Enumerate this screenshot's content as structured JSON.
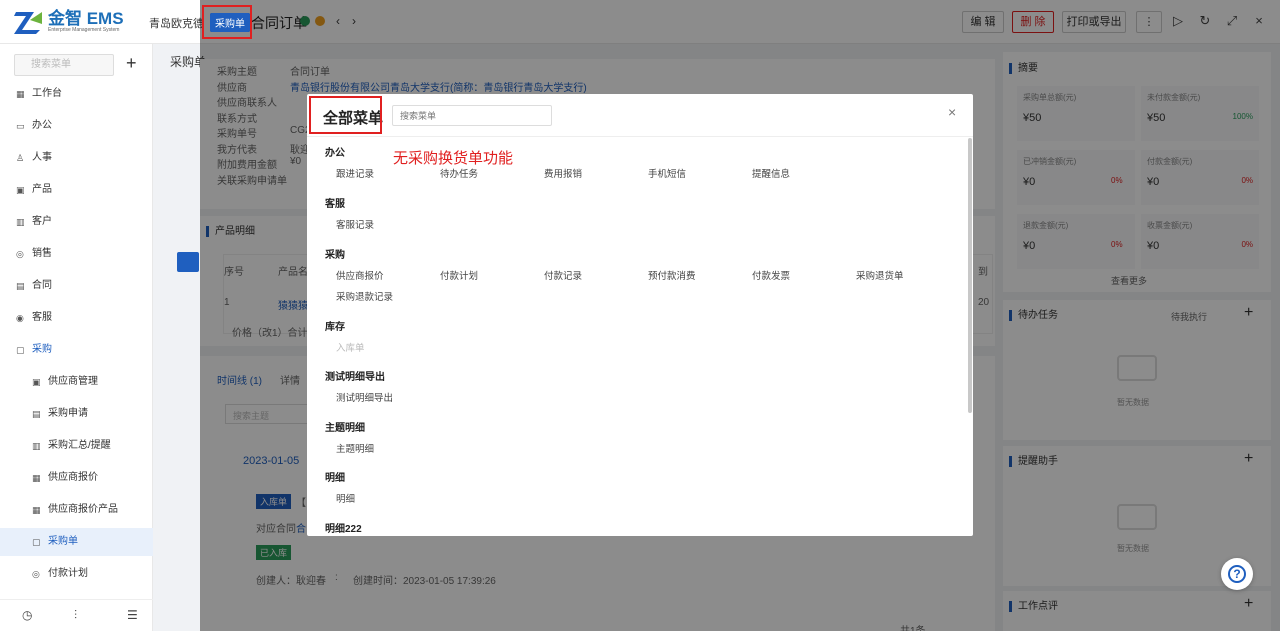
{
  "header": {
    "logo_text": "金智 EMS",
    "logo_sub": "Enterprise Management System",
    "company": "青岛欧克德",
    "doc_badge": "采购单",
    "doc_title": "合同订单",
    "edit_label": "编 辑",
    "delete_label": "删 除",
    "print_label": "打印或导出",
    "more_label": "⋮"
  },
  "sidebar": {
    "search_placeholder": "搜索菜单",
    "items": [
      {
        "icon": "dashboard-icon",
        "glyph": "▦",
        "label": "工作台"
      },
      {
        "icon": "office-icon",
        "glyph": "▭",
        "label": "办公"
      },
      {
        "icon": "person-icon",
        "glyph": "♙",
        "label": "人事"
      },
      {
        "icon": "product-icon",
        "glyph": "▣",
        "label": "产品"
      },
      {
        "icon": "customer-icon",
        "glyph": "▥",
        "label": "客户"
      },
      {
        "icon": "sales-icon",
        "glyph": "◎",
        "label": "销售"
      },
      {
        "icon": "contract-icon",
        "glyph": "▤",
        "label": "合同"
      },
      {
        "icon": "service-icon",
        "glyph": "◉",
        "label": "客服"
      },
      {
        "icon": "purchase-icon",
        "glyph": "▢",
        "label": "采购"
      }
    ],
    "sub_items": [
      {
        "icon": "supplier-icon",
        "glyph": "▣",
        "label": "供应商管理"
      },
      {
        "icon": "request-icon",
        "glyph": "▤",
        "label": "采购申请"
      },
      {
        "icon": "summary-icon",
        "glyph": "▥",
        "label": "采购汇总/提醒"
      },
      {
        "icon": "quote-icon",
        "glyph": "▦",
        "label": "供应商报价"
      },
      {
        "icon": "quote-product-icon",
        "glyph": "▦",
        "label": "供应商报价产品"
      },
      {
        "icon": "order-icon",
        "glyph": "▢",
        "label": "采购单"
      },
      {
        "icon": "plan-icon",
        "glyph": "◎",
        "label": "付款计划"
      }
    ],
    "bottom_icons": [
      "history-icon",
      "filter-icon",
      "settings-icon"
    ]
  },
  "background": {
    "section_title": "采购单",
    "fields": [
      {
        "label": "采购主题",
        "value": "合同订单"
      },
      {
        "label": "供应商",
        "value": "青岛银行股份有限公司青岛大学支行(简称：青岛银行青岛大学支行)"
      },
      {
        "label": "供应商联系人",
        "value": ""
      },
      {
        "label": "联系方式",
        "value": ""
      },
      {
        "label": "采购单号",
        "value": "CG2"
      },
      {
        "label": "我方代表",
        "value": "耿迎"
      },
      {
        "label": "附加费用金额",
        "value": "¥0"
      },
      {
        "label": "关联采购申请单",
        "value": ""
      }
    ],
    "product_section": "产品明细",
    "table_headers": [
      "序号",
      "产品名",
      "到"
    ],
    "table_row": [
      "1",
      "猿猿猿",
      "20"
    ],
    "price_text": "价格（改1）合计",
    "tabs": [
      "时间线 (1)",
      "详情"
    ],
    "search_placeholder": "搜索主题",
    "timeline_date": "2023-01-05",
    "timeline_badge": "入库单",
    "timeline_bracket": "【",
    "timeline_text": "对应合同",
    "timeline_link": "合",
    "status_tag": "已入库",
    "creator_text": "创建人：耿迎春",
    "colon": ":",
    "created_time": "创建时间：2023-01-05 17:39:26",
    "pagination": "共1条"
  },
  "right_panel": {
    "summary_title": "摘要",
    "stats": [
      {
        "title": "采购单总额(元)",
        "value": "¥50",
        "percent": ""
      },
      {
        "title": "未付款金额(元)",
        "value": "¥50",
        "percent": "100%",
        "percent_color": "#2a9d5c"
      },
      {
        "title": "已冲销金额(元)",
        "value": "¥0",
        "percent": ""
      },
      {
        "title": "付款金额(元)",
        "value": "¥0",
        "percent": "0%",
        "percent_color": "#e02020",
        "percent_left": true
      },
      {
        "title": "退款金额(元)",
        "value": "¥0",
        "percent": ""
      },
      {
        "title": "收票金额(元)",
        "value": "¥0",
        "percent": "0%",
        "percent_color": "#e02020"
      }
    ],
    "stat_percents_left": [
      "0%",
      "0%"
    ],
    "see_more": "查看更多",
    "todo_title": "待办任务",
    "todo_filter": "待我执行",
    "empty_text": "暂无数据",
    "reminder_title": "提醒助手",
    "review_title": "工作点评"
  },
  "modal": {
    "title": "全部菜单",
    "search_placeholder": "搜索菜单",
    "close_glyph": "×",
    "annotation": "无采购换货单功能",
    "categories": [
      {
        "name": "办公",
        "items": [
          "跟进记录",
          "待办任务",
          "费用报销",
          "手机短信",
          "提醒信息"
        ]
      },
      {
        "name": "客服",
        "items": [
          "客服记录"
        ]
      },
      {
        "name": "采购",
        "items": [
          "供应商报价",
          "付款计划",
          "付款记录",
          "预付款消费",
          "付款发票",
          "采购退货单",
          "采购退款记录"
        ]
      },
      {
        "name": "库存",
        "items": [
          "入库单"
        ]
      },
      {
        "name": "测试明细导出",
        "items": [
          "测试明细导出"
        ]
      },
      {
        "name": "主题明细",
        "items": [
          "主题明细"
        ]
      },
      {
        "name": "明细",
        "items": [
          "明细"
        ]
      },
      {
        "name": "明细222",
        "items": []
      }
    ]
  },
  "colors": {
    "accent": "#1f5fbf",
    "danger": "#e02020",
    "annotation_red": "#e02020"
  },
  "help_label": "?"
}
